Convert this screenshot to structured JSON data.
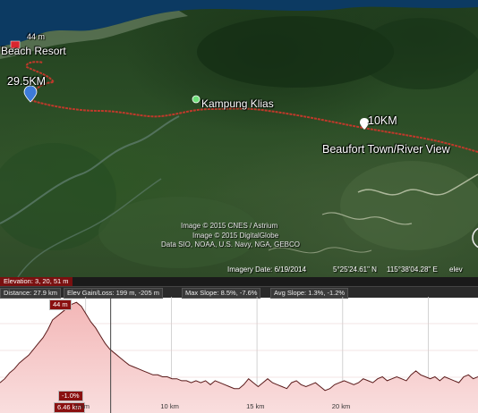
{
  "map": {
    "labels": {
      "resort_elev": "44 m",
      "beach_resort": "Beach Resort",
      "km_29_5": "29.5KM",
      "kampung_klias": "Kampung Klias",
      "km_10": "10KM",
      "beaufort": "Beaufort Town/River View"
    },
    "credits": {
      "line1": "Image © 2015 CNES / Astrium",
      "line2": "Image © 2015 DigitalGlobe",
      "line3": "Data SIO, NOAA, U.S. Navy, NGA, GEBCO"
    },
    "status": {
      "imagery_date": "Imagery Date: 6/19/2014",
      "lat": "5°25'24.61\" N",
      "lon": "115°38'04.28\" E",
      "elev": "elev"
    },
    "colors": {
      "route": "#c0392b",
      "pin_blue": "#3d7bd9",
      "pin_green": "#6fe07a"
    }
  },
  "profile": {
    "elevation_readout": "Elevation: 3, 20, 51 m",
    "stats": {
      "distance": "Distance: 27.9 km",
      "gain_loss": "Elev Gain/Loss: 199 m, -205 m",
      "max_slope": "Max Slope: 8.5%, -7.6%",
      "avg_slope": "Avg Slope: 1.3%, -1.2%"
    },
    "cursor_elev": "44 m",
    "cursor_slope": "-1.0%",
    "cursor_km": "6.46 km",
    "ticks": [
      "5 km",
      "10 km",
      "15 km",
      "20 km"
    ],
    "elevation_samples": [
      10,
      12,
      15,
      17,
      20,
      22,
      24,
      27,
      30,
      33,
      37,
      42,
      44,
      46,
      48,
      50,
      51,
      49,
      45,
      41,
      38,
      34,
      30,
      27,
      25,
      23,
      21,
      19,
      18,
      17,
      16,
      15,
      14,
      14,
      13,
      13,
      12,
      12,
      11,
      11,
      10,
      11,
      10,
      11,
      9,
      11,
      10,
      9,
      8,
      7,
      7,
      9,
      12,
      10,
      8,
      10,
      12,
      10,
      9,
      8,
      7,
      10,
      11,
      9,
      8,
      9,
      10,
      8,
      6,
      7,
      9,
      10,
      11,
      10,
      9,
      10,
      12,
      11,
      10,
      12,
      13,
      11,
      12,
      13,
      12,
      11,
      14,
      16,
      14,
      13,
      12,
      13,
      11,
      13,
      12,
      11,
      10,
      13,
      14,
      12,
      13
    ],
    "total_km": 27.9
  }
}
